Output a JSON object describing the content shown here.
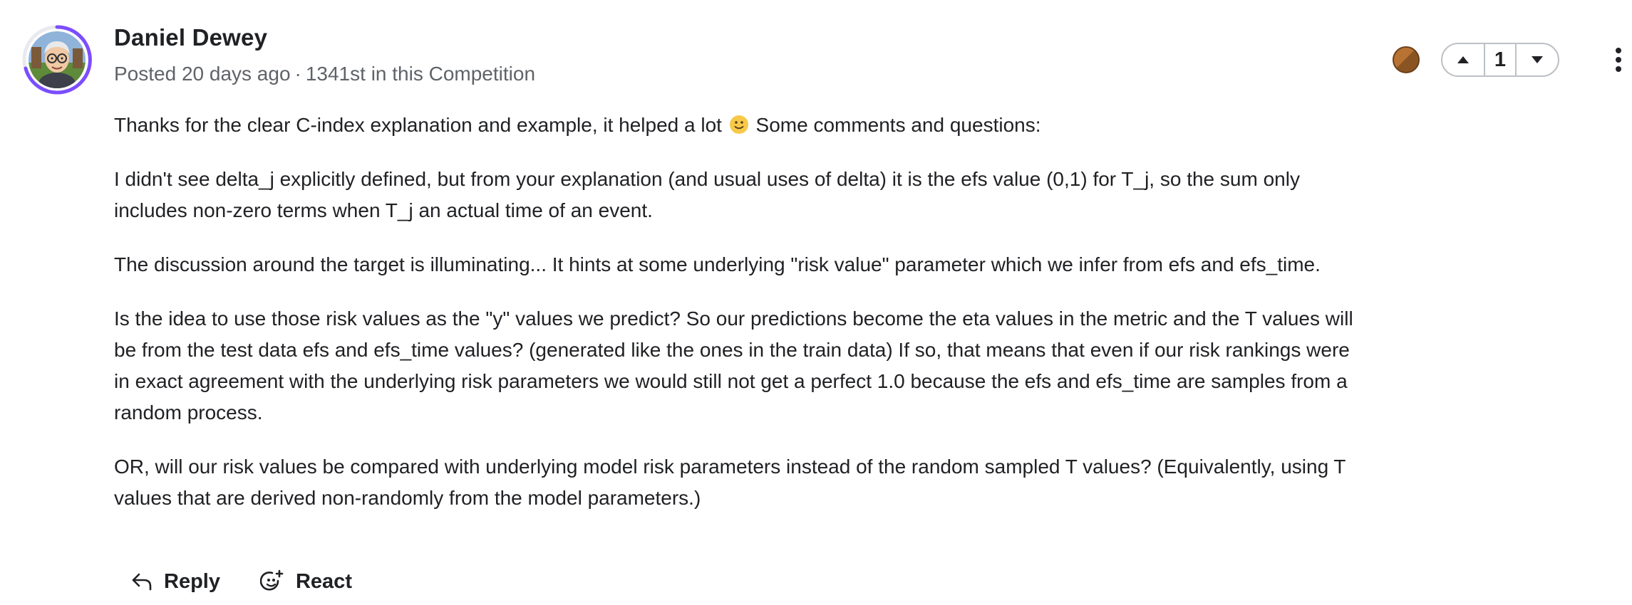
{
  "author": {
    "name": "Daniel Dewey",
    "posted": "Posted 20 days ago",
    "separator": "·",
    "rank": "1341st in this Competition",
    "avatar_icon": "avatar-cartoon-man-with-glasses",
    "ring_color": "#7c4dff"
  },
  "medal": {
    "icon": "bronze-medal-icon",
    "color": "#b87333"
  },
  "vote": {
    "upvote_icon": "upvote-arrow-icon",
    "count": "1",
    "downvote_icon": "downvote-arrow-icon"
  },
  "more_icon": "more-vertical-icon",
  "body": {
    "p1_before_emoji": "Thanks for the clear C-index explanation and example, it helped a lot",
    "p1_after_emoji": "Some comments and questions:",
    "p2": "I didn't see delta_j explicitly defined, but from your explanation (and usual uses of delta) it is the efs value (0,1) for T_j, so the sum only includes non-zero terms when T_j an actual time of an event.",
    "p3": "The discussion around the target is illuminating... It hints at some underlying \"risk value\" parameter which we infer from efs and efs_time.",
    "p4": "Is the idea to use those risk values as the \"y\" values we predict? So our predictions become the eta values in the metric and the T values will be from the test data efs and efs_time values? (generated like the ones in the train data) If so, that means that even if our risk rankings were in exact agreement with the underlying risk parameters we would still not get a perfect 1.0 because the efs and efs_time are samples from a random process.",
    "p5": "OR, will our risk values be compared with underlying model risk parameters instead of the random sampled T values? (Equivalently, using T values that are derived non-randomly from the model parameters.)"
  },
  "actions": {
    "reply_label": "Reply",
    "reply_icon": "reply-arrow-icon",
    "react_label": "React",
    "react_icon": "add-reaction-icon"
  }
}
